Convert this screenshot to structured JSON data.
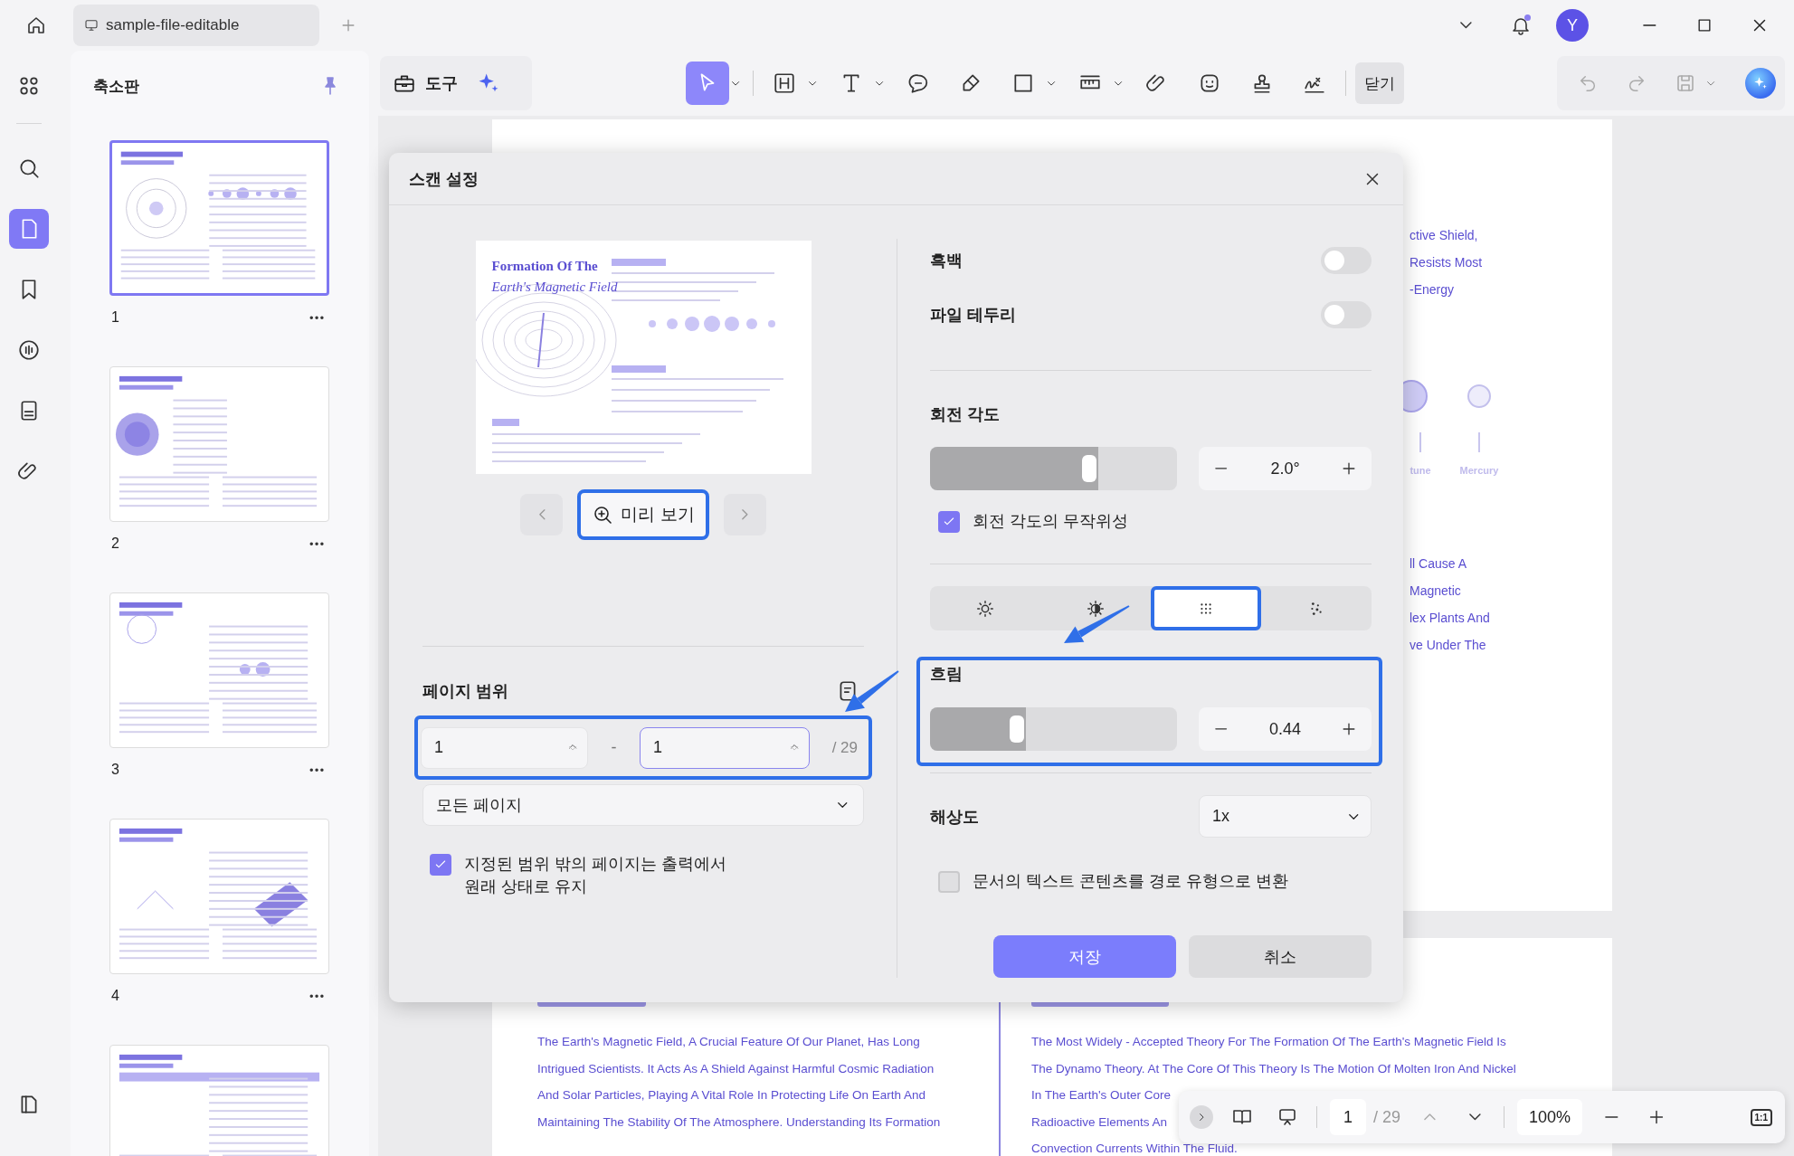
{
  "window": {
    "tab_title": "sample-file-editable",
    "account_initial": "Y",
    "notification": true
  },
  "rail": [
    {
      "kind": "grid",
      "selected": false
    },
    {
      "kind": "search",
      "selected": false
    },
    {
      "kind": "pages",
      "selected": true
    },
    {
      "kind": "bookmark",
      "selected": false
    },
    {
      "kind": "comments",
      "selected": false
    },
    {
      "kind": "forms",
      "selected": false
    },
    {
      "kind": "attachments",
      "selected": false
    }
  ],
  "thumbnail_panel": {
    "title": "축소판",
    "pages": [
      {
        "number": "1",
        "selected": true
      },
      {
        "number": "2",
        "selected": false
      },
      {
        "number": "3",
        "selected": false
      },
      {
        "number": "4",
        "selected": false
      },
      {
        "selected": false
      }
    ]
  },
  "toolbar": {
    "tools_label": "도구",
    "close_label": "닫기",
    "tools": [
      {
        "kind": "select",
        "selected": true,
        "menu": true
      },
      {
        "kind": "heading",
        "selected": false,
        "menu": true
      },
      {
        "kind": "text",
        "selected": false,
        "menu": true
      },
      {
        "kind": "comment",
        "selected": false
      },
      {
        "kind": "highlighter",
        "selected": false
      },
      {
        "kind": "shape",
        "selected": false,
        "menu": true
      },
      {
        "kind": "measure",
        "selected": false,
        "menu": true
      },
      {
        "kind": "attachment",
        "selected": false
      },
      {
        "kind": "sticker",
        "selected": false
      },
      {
        "kind": "stamp",
        "selected": false
      },
      {
        "kind": "signature",
        "selected": false
      }
    ]
  },
  "document": {
    "right_lines_top": [
      "ctive Shield,",
      "Resists Most",
      "-Energy"
    ],
    "planet_labels": [
      "tune",
      "Mercury"
    ],
    "right_lines_bottom": [
      "ll Cause A",
      "Magnetic",
      "lex Plants And",
      "ve Under The"
    ],
    "page2_left": [
      "The Earth's Magnetic Field, A Crucial Feature Of Our Planet, Has Long",
      "Intrigued Scientists. It Acts As A Shield Against Harmful Cosmic Radiation",
      "And Solar Particles, Playing A Vital Role In Protecting Life On Earth And",
      "Maintaining The Stability Of The Atmosphere. Understanding Its Formation"
    ],
    "page2_right": [
      "The Most Widely - Accepted Theory For The Formation Of The Earth's Magnetic Field Is",
      "The Dynamo Theory. At The Core Of This Theory Is The Motion Of Molten Iron And Nickel",
      "In The Earth's Outer Core",
      "Radioactive Elements An",
      "Convection Currents Within The Fluid."
    ]
  },
  "dialog": {
    "title": "스캔 설정",
    "preview": {
      "heading": "Formation Of The",
      "subheading": "Earth's Magnetic Field",
      "button": "미리 보기",
      "highlighted": true
    },
    "page_range": {
      "label": "페이지 범위",
      "from": "1",
      "separator": "-",
      "to": "1",
      "total": "/ 29",
      "highlighted": true,
      "mode": "모든 페이지",
      "keep_outside": {
        "label": "지정된 범위 밖의 페이지는 출력에서\n원래 상태로 유지",
        "checked": true
      }
    },
    "toggles": [
      {
        "label": "흑백",
        "on": false
      },
      {
        "label": "파일 테두리",
        "on": false
      }
    ],
    "rotation": {
      "label": "회전 각도",
      "level": 0.68,
      "value": "2.0°",
      "random": {
        "label": "회전 각도의 무작위성",
        "checked": true
      }
    },
    "effects": [
      {
        "kind": "brightness",
        "selected": false
      },
      {
        "kind": "contrast",
        "selected": false
      },
      {
        "kind": "fine-noise",
        "selected": true
      },
      {
        "kind": "coarse-noise",
        "selected": false
      }
    ],
    "blur": {
      "label": "흐림",
      "level": 0.39,
      "value": "0.44",
      "highlighted": true
    },
    "resolution": {
      "label": "해상도",
      "value": "1x"
    },
    "text_to_path": {
      "label": "문서의 텍스트 콘텐츠를 경로 유형으로 변환",
      "checked": false
    },
    "buttons": [
      {
        "kind": "primary",
        "label": "저장"
      },
      {
        "kind": "secondary",
        "label": "취소"
      }
    ]
  },
  "nav_bar": {
    "page": "1",
    "total": "/ 29",
    "zoom": "100%",
    "fit": "1:1"
  }
}
